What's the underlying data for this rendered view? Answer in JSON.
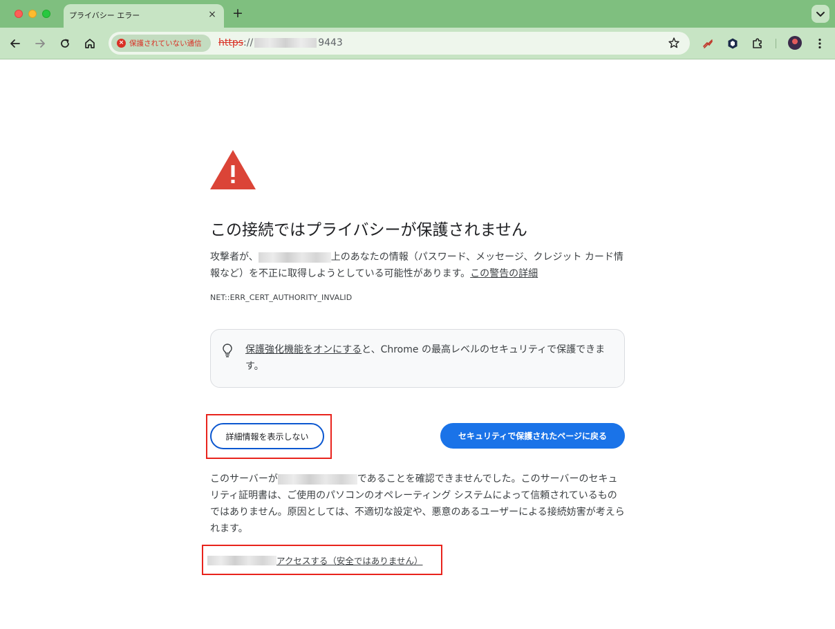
{
  "tab": {
    "title": "プライバシー エラー",
    "close": "×",
    "new_tab": "+"
  },
  "toolbar": {
    "security_chip": "保護されていない通信",
    "url_scheme": "https",
    "url_sep": "://",
    "url_port": "9443"
  },
  "page": {
    "heading": "この接続ではプライバシーが保護されません",
    "desc_prefix": "攻撃者が、",
    "desc_mid": "上のあなたの情報（パスワード、メッセージ、クレジット カード情報など）を不正に取得しようとしている可能性があります。",
    "desc_link": "この警告の詳細",
    "error_code": "NET::ERR_CERT_AUTHORITY_INVALID",
    "tip_link": "保護強化機能をオンにする",
    "tip_text": "と、Chrome の最高レベルのセキュリティで保護できます。",
    "details_button": "詳細情報を表示しない",
    "back_button": "セキュリティで保護されたページに戻る",
    "explain_prefix": "このサーバーが",
    "explain_rest": "であることを確認できませんでした。このサーバーのセキュリティ証明書は、ご使用のパソコンのオペレーティング システムによって信頼されているものではありません。原因としては、不適切な設定や、悪意のあるユーザーによる接続妨害が考えられます。",
    "proceed_link": "アクセスする（安全ではありません）"
  },
  "colors": {
    "accent": "#1a73e8",
    "error": "#d93025",
    "highlight": "#e8231c",
    "chrome": "#c7e4c4"
  }
}
